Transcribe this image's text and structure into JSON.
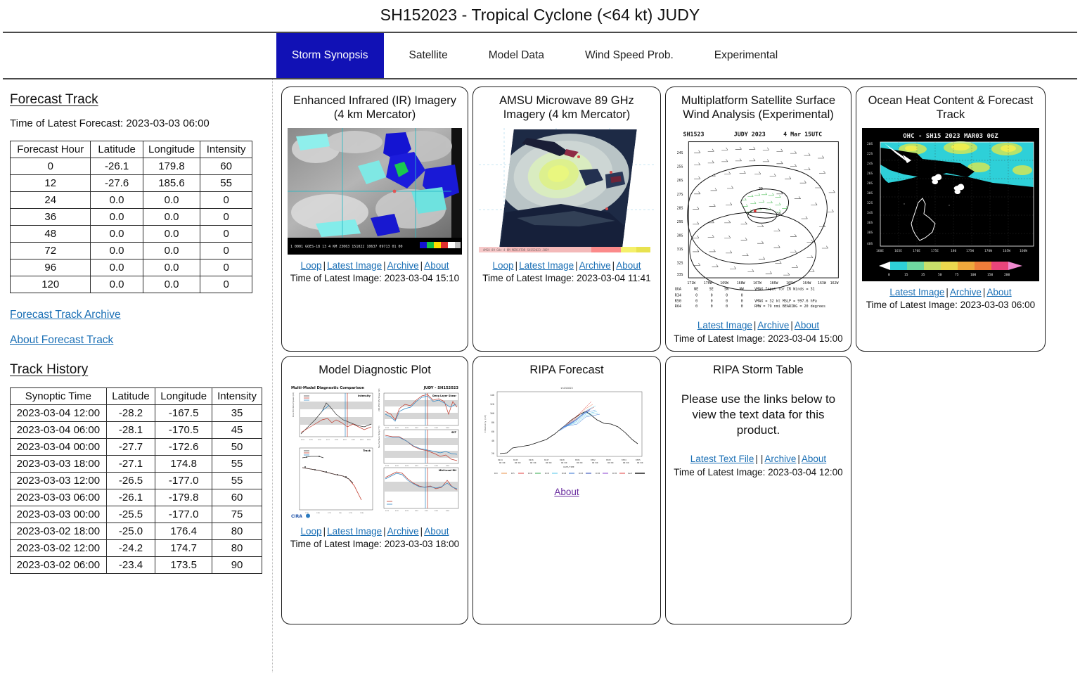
{
  "header": {
    "title": "SH152023 - Tropical Cyclone (<64 kt) JUDY"
  },
  "tabs": [
    {
      "label": "Storm Synopsis",
      "active": true
    },
    {
      "label": "Satellite",
      "active": false
    },
    {
      "label": "Model Data",
      "active": false
    },
    {
      "label": "Wind Speed Prob.",
      "active": false
    },
    {
      "label": "Experimental",
      "active": false
    }
  ],
  "colors": {
    "active_tab_bg": "#1111b5",
    "active_tab_fg": "#ffffff",
    "link": "#1a6fb5",
    "visited_link": "#6b2ea0",
    "rule": "#4a4a4a",
    "card_border": "#1d1d1d"
  },
  "sidebar": {
    "forecast_track": {
      "heading": "Forecast Track",
      "latest_forecast_label": "Time of Latest Forecast: 2023-03-03 06:00",
      "columns": [
        "Forecast Hour",
        "Latitude",
        "Longitude",
        "Intensity"
      ],
      "rows": [
        [
          "0",
          "-26.1",
          "179.8",
          "60"
        ],
        [
          "12",
          "-27.6",
          "185.6",
          "55"
        ],
        [
          "24",
          "0.0",
          "0.0",
          "0"
        ],
        [
          "36",
          "0.0",
          "0.0",
          "0"
        ],
        [
          "48",
          "0.0",
          "0.0",
          "0"
        ],
        [
          "72",
          "0.0",
          "0.0",
          "0"
        ],
        [
          "96",
          "0.0",
          "0.0",
          "0"
        ],
        [
          "120",
          "0.0",
          "0.0",
          "0"
        ]
      ],
      "archive_link": "Forecast Track Archive",
      "about_link": "About Forecast Track"
    },
    "track_history": {
      "heading": "Track History",
      "columns": [
        "Synoptic Time",
        "Latitude",
        "Longitude",
        "Intensity"
      ],
      "rows": [
        [
          "2023-03-04 12:00",
          "-28.2",
          "-167.5",
          "35"
        ],
        [
          "2023-03-04 06:00",
          "-28.1",
          "-170.5",
          "45"
        ],
        [
          "2023-03-04 00:00",
          "-27.7",
          "-172.6",
          "50"
        ],
        [
          "2023-03-03 18:00",
          "-27.1",
          "174.8",
          "55"
        ],
        [
          "2023-03-03 12:00",
          "-26.5",
          "-177.0",
          "55"
        ],
        [
          "2023-03-03 06:00",
          "-26.1",
          "-179.8",
          "60"
        ],
        [
          "2023-03-03 00:00",
          "-25.5",
          "-177.0",
          "75"
        ],
        [
          "2023-03-02 18:00",
          "-25.0",
          "176.4",
          "80"
        ],
        [
          "2023-03-02 12:00",
          "-24.2",
          "174.7",
          "80"
        ],
        [
          "2023-03-02 06:00",
          "-23.4",
          "173.5",
          "90"
        ]
      ]
    }
  },
  "cards": {
    "ir": {
      "title": "Enhanced Infrared (IR) Imagery (4 km Mercator)",
      "links": [
        "Loop",
        "Latest Image",
        "Archive",
        "About"
      ],
      "time": "Time of Latest Image: 2023-03-04 15:10",
      "overlay": "1 0001 GOES-18   13   4 KM 23063 151022 10637 09713 01 00   MJ1046"
    },
    "amsu": {
      "title": "AMSU Microwave 89 GHz Imagery (4 km Mercator)",
      "links": [
        "Loop",
        "Latest Image",
        "Archive",
        "About"
      ],
      "time": "Time of Latest Image: 2023-03-04 11:41"
    },
    "mtcswa": {
      "title": "Multiplatform Satellite Surface Wind Analysis (Experimental)",
      "plot_header_left": "SH1523",
      "plot_header_mid": "JUDY 2023",
      "plot_header_right": "4 Mar 15UTC",
      "y_ticks": [
        "24S",
        "25S",
        "26S",
        "27S",
        "28S",
        "29S",
        "30S",
        "31S",
        "32S",
        "33S"
      ],
      "x_ticks": [
        "171W",
        "170W",
        "169W",
        "168W",
        "167W",
        "166W",
        "165W",
        "164W",
        "163W",
        "162W"
      ],
      "quad_header": [
        "QUA",
        "NE",
        "SE",
        "SW",
        "NW"
      ],
      "quad_rows": [
        [
          "R34",
          "0",
          "0",
          "0",
          "0"
        ],
        [
          "R50",
          "0",
          "0",
          "0",
          "0"
        ],
        [
          "R64",
          "0",
          "0",
          "0",
          "0"
        ]
      ],
      "stat_line1": "VMAX Input for IR Winds =     31",
      "stat_line2": "VMAX  =     32 kt MSLP =   997.6 hPa",
      "stat_line3": "RMW   =    79 nmi BEARING =    20 degrees",
      "links": [
        "Latest Image",
        "Archive",
        "About"
      ],
      "time": "Time of Latest Image: 2023-03-04 15:00"
    },
    "ohc": {
      "title": "Ocean Heat Content & Forecast Track",
      "plot_title": "OHC  -  SH15 2023 MAR03 06Z",
      "y_ticks": [
        "20S",
        "22S",
        "24S",
        "26S",
        "28S",
        "30S",
        "32S",
        "34S",
        "36S",
        "38S",
        "40S"
      ],
      "x_ticks": [
        "160E",
        "165E",
        "170E",
        "175E",
        "180",
        "175W",
        "170W",
        "165W",
        "160W"
      ],
      "colorbar_ticks": [
        "0",
        "15",
        "35",
        "50",
        "75",
        "100",
        "150",
        "200"
      ],
      "links": [
        "Latest Image",
        "Archive",
        "About"
      ],
      "time": "Time of Latest Image: 2023-03-03 06:00"
    },
    "mdp": {
      "title": "Model Diagnostic Plot",
      "plot_title_left": "Multi-Model Diagnostic Comparison",
      "plot_title_right": "JUDY - SH152023",
      "panel_labels": [
        "Intensity",
        "Deep Layer Shear",
        "Track",
        "SST",
        "Mid-Level RH"
      ],
      "links": [
        "Loop",
        "Latest Image",
        "Archive",
        "About"
      ],
      "time": "Time of Latest Image: 2023-03-03 18:00"
    },
    "ripa_forecast": {
      "title": "RIPA Forecast",
      "plot_title": "sh152023",
      "ylabel": "Intensity (kt)",
      "xlabel": "DATE/TIME",
      "y_ticks": [
        "140",
        "120",
        "100",
        "80",
        "60",
        "40",
        "20"
      ],
      "x_ticks": [
        "0224\n00:00",
        "0225\n00:00",
        "0226\n00:00",
        "0227\n00:00",
        "0228\n00:00",
        "0301\n00:00",
        "0302\n00:00",
        "0303\n00:00",
        "0304\n00:00",
        "0305\n00:00"
      ],
      "legend": [
        "R=0",
        "R=5",
        "R=10",
        "R=15",
        "R=20",
        "R=25",
        "R=30",
        "R=35",
        "R=40",
        "best"
      ],
      "links": [
        "About"
      ],
      "time": ""
    },
    "ripa_table": {
      "title": "RIPA Storm Table",
      "note": "Please use the links below to view the text data for this product.",
      "links": [
        "Latest Text File",
        "Archive",
        "About"
      ],
      "time": "Time of Latest Image: 2023-03-04 12:00"
    }
  },
  "chart_data": [
    {
      "type": "table",
      "title": "Forecast Track",
      "columns": [
        "Forecast Hour",
        "Latitude",
        "Longitude",
        "Intensity"
      ],
      "rows": [
        [
          0,
          -26.1,
          179.8,
          60
        ],
        [
          12,
          -27.6,
          185.6,
          55
        ],
        [
          24,
          0.0,
          0.0,
          0
        ],
        [
          36,
          0.0,
          0.0,
          0
        ],
        [
          48,
          0.0,
          0.0,
          0
        ],
        [
          72,
          0.0,
          0.0,
          0
        ],
        [
          96,
          0.0,
          0.0,
          0
        ],
        [
          120,
          0.0,
          0.0,
          0
        ]
      ]
    },
    {
      "type": "table",
      "title": "Track History",
      "columns": [
        "Synoptic Time",
        "Latitude",
        "Longitude",
        "Intensity"
      ],
      "rows": [
        [
          "2023-03-04 12:00",
          -28.2,
          -167.5,
          35
        ],
        [
          "2023-03-04 06:00",
          -28.1,
          -170.5,
          45
        ],
        [
          "2023-03-04 00:00",
          -27.7,
          -172.6,
          50
        ],
        [
          "2023-03-03 18:00",
          -27.1,
          174.8,
          55
        ],
        [
          "2023-03-03 12:00",
          -26.5,
          -177.0,
          55
        ],
        [
          "2023-03-03 06:00",
          -26.1,
          -179.8,
          60
        ],
        [
          "2023-03-03 00:00",
          -25.5,
          -177.0,
          75
        ],
        [
          "2023-03-02 18:00",
          -25.0,
          176.4,
          80
        ],
        [
          "2023-03-02 12:00",
          -24.2,
          174.7,
          80
        ],
        [
          "2023-03-02 06:00",
          -23.4,
          173.5,
          90
        ]
      ]
    },
    {
      "type": "line",
      "title": "RIPA Forecast intensity",
      "xlabel": "DATE/TIME",
      "ylabel": "Intensity (kt)",
      "ylim": [
        20,
        145
      ],
      "x": [
        "0224 00:00",
        "0225 00:00",
        "0226 00:00",
        "0227 00:00",
        "0228 00:00",
        "0301 00:00",
        "0302 00:00",
        "0303 00:00",
        "0304 00:00",
        "0305 00:00"
      ],
      "series": [
        {
          "name": "best",
          "values": [
            22,
            27,
            33,
            42,
            62,
            100,
            92,
            78,
            62,
            33
          ]
        }
      ]
    }
  ]
}
